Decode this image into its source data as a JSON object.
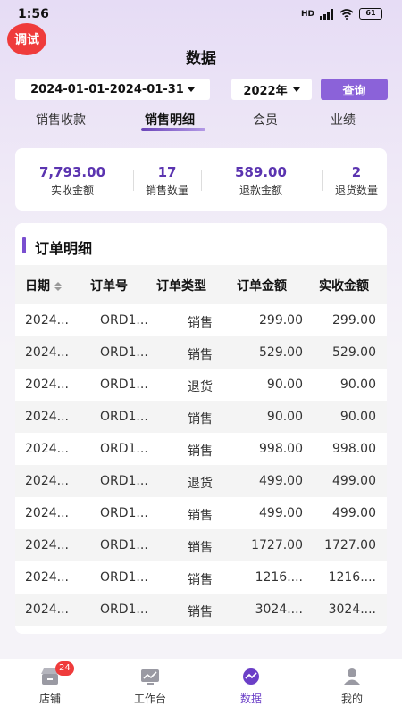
{
  "status_bar": {
    "time": "1:56",
    "network": "HD",
    "battery": "61"
  },
  "debug_badge": "调试",
  "page_title": "数据",
  "filters": {
    "date_range": "2024-01-01-2024-01-31",
    "year": "2022年",
    "query_label": "查询"
  },
  "tabs": [
    {
      "label": "销售收款",
      "active": false
    },
    {
      "label": "销售明细",
      "active": true
    },
    {
      "label": "会员",
      "active": false
    },
    {
      "label": "业绩",
      "active": false
    }
  ],
  "summary": [
    {
      "value": "7,793.00",
      "label": "实收金额"
    },
    {
      "value": "17",
      "label": "销售数量"
    },
    {
      "value": "589.00",
      "label": "退款金额"
    },
    {
      "value": "2",
      "label": "退货数量"
    }
  ],
  "orders": {
    "title": "订单明细",
    "columns": [
      "日期",
      "订单号",
      "订单类型",
      "订单金额",
      "实收金额"
    ],
    "rows": [
      [
        "2024...",
        "ORD1...",
        "销售",
        "299.00",
        "299.00"
      ],
      [
        "2024...",
        "ORD1...",
        "销售",
        "529.00",
        "529.00"
      ],
      [
        "2024...",
        "ORD1...",
        "退货",
        "90.00",
        "90.00"
      ],
      [
        "2024...",
        "ORD1...",
        "销售",
        "90.00",
        "90.00"
      ],
      [
        "2024...",
        "ORD1...",
        "销售",
        "998.00",
        "998.00"
      ],
      [
        "2024...",
        "ORD1...",
        "退货",
        "499.00",
        "499.00"
      ],
      [
        "2024...",
        "ORD1...",
        "销售",
        "499.00",
        "499.00"
      ],
      [
        "2024...",
        "ORD1...",
        "销售",
        "1727.00",
        "1727.00"
      ],
      [
        "2024...",
        "ORD1...",
        "销售",
        "1216....",
        "1216...."
      ],
      [
        "2024...",
        "ORD1...",
        "销售",
        "3024....",
        "3024...."
      ]
    ]
  },
  "bottom_nav": [
    {
      "label": "店铺",
      "icon": "store-icon",
      "active": false
    },
    {
      "label": "工作台",
      "icon": "workbench-icon",
      "active": false
    },
    {
      "label": "数据",
      "icon": "data-icon",
      "active": true
    },
    {
      "label": "我的",
      "icon": "profile-icon",
      "active": false
    }
  ],
  "nav_badge": "24",
  "colors": {
    "accent": "#8b62d9",
    "stat_value": "#5b34b0",
    "badge": "#ef3b3b"
  }
}
